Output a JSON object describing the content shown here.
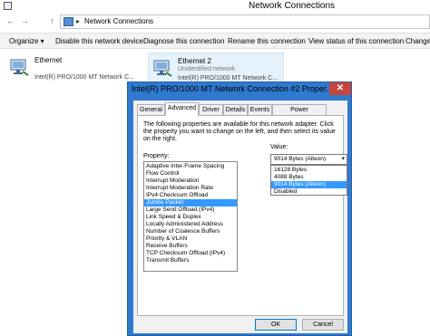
{
  "window": {
    "title": "Network Connections"
  },
  "address": {
    "path": "Network Connections",
    "separator": "▸"
  },
  "nav": {
    "back": "←",
    "forward": "→",
    "up": "↑"
  },
  "commands": [
    "Organize ▾",
    "Disable this network device",
    "Diagnose this connection",
    "Rename this connection",
    "View status of this connection",
    "Change"
  ],
  "adapters": [
    {
      "name": "Ethernet",
      "status": "",
      "description": "Intel(R) PRO/1000 MT Network C..."
    },
    {
      "name": "Ethernet 2",
      "status": "Unidentified network",
      "description": "Intel(R) PRO/1000 MT Network C..."
    }
  ],
  "dialog": {
    "title": "Intel(R) PRO/1000 MT Network Connection #2 Proper...",
    "close": "✕",
    "tabs": [
      "General",
      "Advanced",
      "Driver",
      "Details",
      "Events",
      "Power Management"
    ],
    "active_tab": "Advanced",
    "description": "The following properties are available for this network adapter. Click the property you want to change on the left, and then select its value on the right.",
    "property_label": "Property:",
    "value_label": "Value:",
    "properties": [
      "Adaptive Inter-Frame Spacing",
      "Flow Control",
      "Interrupt Moderation",
      "Interrupt Moderation Rate",
      "IPv4 Checksum Offload",
      "Jumbo Packet",
      "Large Send Offload (IPv4)",
      "Link Speed & Duplex",
      "Locally Administered Address",
      "Number of Coalesce Buffers",
      "Priority & VLAN",
      "Receive Buffers",
      "TCP Checksum Offload (IPv4)",
      "Transmit Buffers"
    ],
    "selected_property": "Jumbo Packet",
    "value_selected": "9014 Bytes (Alteon)",
    "value_options": [
      "16128 Bytes",
      "4088 Bytes",
      "9014 Bytes (Alteon)",
      "Disabled"
    ],
    "ok_label": "OK",
    "cancel_label": "Cancel"
  }
}
